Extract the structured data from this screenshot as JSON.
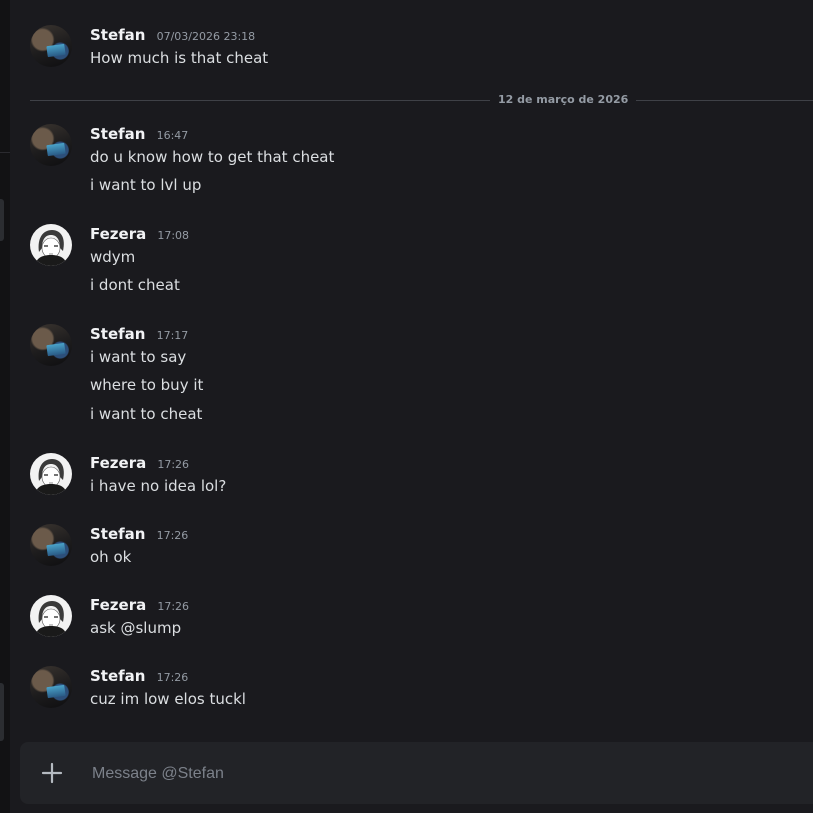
{
  "date_divider": "12 de março de 2026",
  "composer": {
    "placeholder": "Message @Stefan"
  },
  "messages": [
    {
      "author": "Stefan",
      "time": "07/03/2026 23:18",
      "lines": [
        "How much is that cheat"
      ]
    },
    {
      "author": "Stefan",
      "time": "16:47",
      "lines": [
        "do u know how to get that cheat",
        "i want to lvl up"
      ]
    },
    {
      "author": "Fezera",
      "time": "17:08",
      "lines": [
        "wdym",
        "i dont cheat"
      ]
    },
    {
      "author": "Stefan",
      "time": "17:17",
      "lines": [
        "i want to say",
        "where to buy it",
        "i want to cheat"
      ]
    },
    {
      "author": "Fezera",
      "time": "17:26",
      "lines": [
        "i have no idea lol?"
      ]
    },
    {
      "author": "Stefan",
      "time": "17:26",
      "lines": [
        "oh ok"
      ]
    },
    {
      "author": "Fezera",
      "time": "17:26",
      "lines": [
        "ask @slump"
      ]
    },
    {
      "author": "Stefan",
      "time": "17:26",
      "lines": [
        "cuz im low elos tuckl"
      ]
    }
  ]
}
